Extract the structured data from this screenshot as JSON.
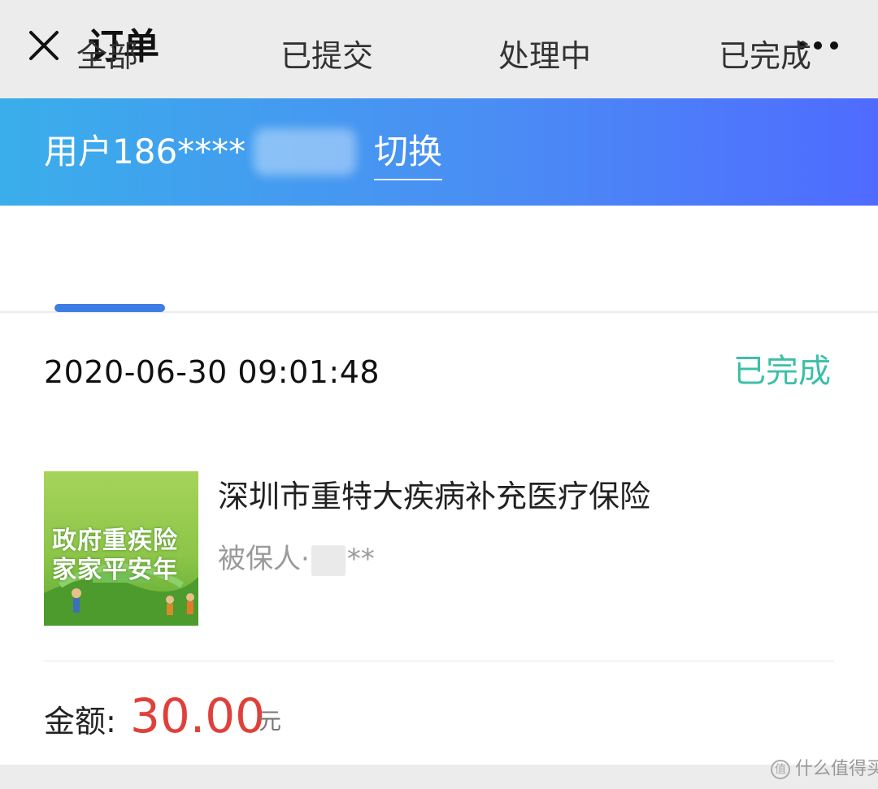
{
  "header": {
    "title": "订单",
    "close_icon": "close-icon",
    "more_icon": "more-horizontal-icon"
  },
  "user": {
    "label": "用户186****",
    "switch_label": "切换"
  },
  "tabs": [
    {
      "label": "全部",
      "selected": true
    },
    {
      "label": "已提交",
      "selected": false
    },
    {
      "label": "处理中",
      "selected": false
    },
    {
      "label": "已完成",
      "selected": false
    }
  ],
  "order": {
    "time": "2020-06-30 09:01:48",
    "status": "已完成",
    "product_name": "深圳市重特大疾病补充医疗保险",
    "insured_prefix": "被保人·",
    "insured_suffix": "**",
    "thumb_text_line1": "政府重疾险",
    "thumb_text_line2": "家家平安年",
    "amount_label": "金额:",
    "amount_value": "30.00",
    "amount_unit": "元"
  },
  "watermark": "什么值得买",
  "colors": {
    "accent": "#3e7de3",
    "status_done": "#3cbfa9",
    "amount": "#e0403a",
    "banner_start": "#3aaeea",
    "banner_end": "#4f6bff"
  }
}
